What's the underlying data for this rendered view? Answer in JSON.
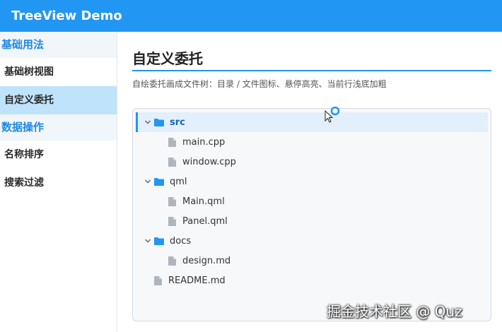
{
  "app": {
    "title": "TreeView Demo"
  },
  "sidebar": {
    "groups": [
      {
        "label": "基础用法",
        "items": [
          {
            "label": "基础树视图",
            "active": false
          },
          {
            "label": "自定义委托",
            "active": true
          }
        ]
      },
      {
        "label": "数据操作",
        "items": [
          {
            "label": "名称排序",
            "active": false
          },
          {
            "label": "搜索过滤",
            "active": false
          }
        ]
      }
    ]
  },
  "main": {
    "title": "自定义委托",
    "description": "自绘委托画成文件树：目录 / 文件图标、悬停高亮、当前行浅底加粗"
  },
  "tree": {
    "nodes": [
      {
        "label": "src",
        "type": "folder",
        "expanded": true,
        "selected": true,
        "icon": "folder-icon"
      },
      {
        "label": "main.cpp",
        "type": "file",
        "icon": "file-icon"
      },
      {
        "label": "window.cpp",
        "type": "file",
        "icon": "file-icon"
      },
      {
        "label": "qml",
        "type": "folder",
        "expanded": true,
        "icon": "folder-icon"
      },
      {
        "label": "Main.qml",
        "type": "file",
        "icon": "file-icon"
      },
      {
        "label": "Panel.qml",
        "type": "file",
        "icon": "file-icon"
      },
      {
        "label": "docs",
        "type": "folder",
        "expanded": true,
        "icon": "folder-icon"
      },
      {
        "label": "design.md",
        "type": "file",
        "icon": "file-icon"
      },
      {
        "label": "README.md",
        "type": "file",
        "icon": "file-icon"
      }
    ]
  },
  "watermark": {
    "text": "掘金技术社区 @ Quz"
  },
  "colors": {
    "accent": "#2196f3",
    "selected_row": "#e3effb",
    "active_nav": "#bfe3fb",
    "folder": "#2196f3",
    "file": "#b0b5bc"
  }
}
